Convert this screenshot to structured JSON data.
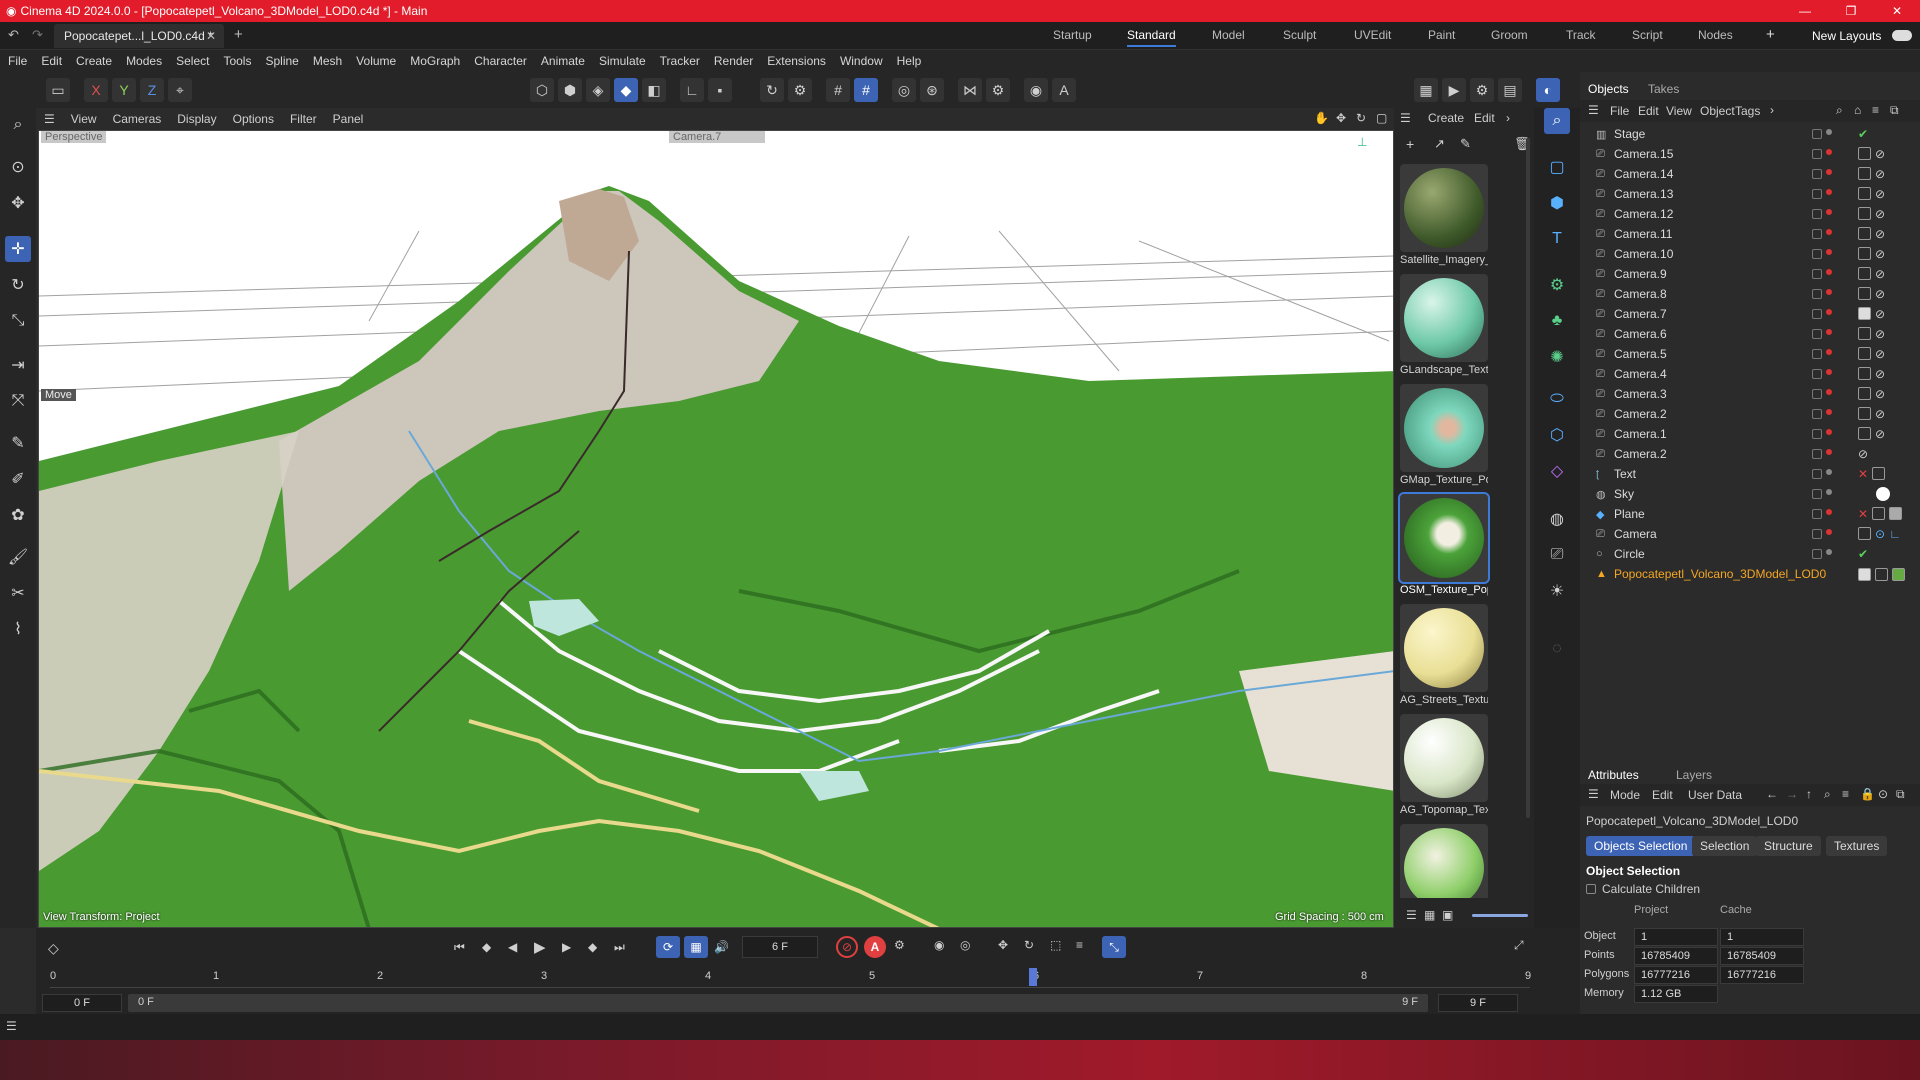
{
  "window": {
    "title": "Cinema 4D 2024.0.0 - [Popocatepetl_Volcano_3DModel_LOD0.c4d *] - Main",
    "minimize": "—",
    "maximize": "❐",
    "close": "✕"
  },
  "tabs": {
    "doc_tab": "Popocatepet...l_LOD0.c4d *",
    "layouts": [
      "Startup",
      "Standard",
      "Model",
      "Sculpt",
      "UVEdit",
      "Paint",
      "Groom",
      "Track",
      "Script",
      "Nodes"
    ],
    "active_layout": "Standard",
    "new_layouts": "New Layouts"
  },
  "menu": [
    "File",
    "Edit",
    "Create",
    "Modes",
    "Select",
    "Tools",
    "Spline",
    "Mesh",
    "Volume",
    "MoGraph",
    "Character",
    "Animate",
    "Simulate",
    "Tracker",
    "Render",
    "Extensions",
    "Window",
    "Help"
  ],
  "axes": {
    "x": "X",
    "y": "Y",
    "z": "Z"
  },
  "viewport": {
    "menu": [
      "View",
      "Cameras",
      "Display",
      "Options",
      "Filter",
      "Panel"
    ],
    "label": "Perspective",
    "camera": "Camera.7",
    "tool_label": "Move",
    "view_transform": "View Transform: Project",
    "grid_spacing": "Grid Spacing : 500 cm",
    "sky_color": "#ffffff",
    "terrain_color": "#3f8f2a"
  },
  "materials": {
    "menu": [
      "Create",
      "Edit"
    ],
    "items": [
      {
        "label": "Satellite_Imagery_",
        "color": "#3f5a2a"
      },
      {
        "label": "GLandscape_Textu",
        "color": "#6ec9a8"
      },
      {
        "label": "GMap_Texture_Po",
        "color": "#7ed8bd"
      },
      {
        "label": "OSM_Texture_Pop",
        "color": "#4ca33a"
      },
      {
        "label": "AG_Streets_Textur",
        "color": "#e9df95"
      },
      {
        "label": "AG_Topomap_Tex",
        "color": "#d9e6c8"
      },
      {
        "label": "",
        "color": "#8fcf6a"
      }
    ]
  },
  "objects": {
    "tabs": [
      "Objects",
      "Takes"
    ],
    "menu": [
      "File",
      "Edit",
      "View",
      "Object",
      "Tags"
    ],
    "items": [
      {
        "name": "Stage",
        "icon": "stage-icon"
      },
      {
        "name": "Camera.15",
        "icon": "camera-icon"
      },
      {
        "name": "Camera.14",
        "icon": "camera-icon"
      },
      {
        "name": "Camera.13",
        "icon": "camera-icon"
      },
      {
        "name": "Camera.12",
        "icon": "camera-icon"
      },
      {
        "name": "Camera.11",
        "icon": "camera-icon"
      },
      {
        "name": "Camera.10",
        "icon": "camera-icon"
      },
      {
        "name": "Camera.9",
        "icon": "camera-icon"
      },
      {
        "name": "Camera.8",
        "icon": "camera-icon"
      },
      {
        "name": "Camera.7",
        "icon": "camera-icon"
      },
      {
        "name": "Camera.6",
        "icon": "camera-icon"
      },
      {
        "name": "Camera.5",
        "icon": "camera-icon"
      },
      {
        "name": "Camera.4",
        "icon": "camera-icon"
      },
      {
        "name": "Camera.3",
        "icon": "camera-icon"
      },
      {
        "name": "Camera.2",
        "icon": "camera-icon"
      },
      {
        "name": "Camera.1",
        "icon": "camera-icon"
      },
      {
        "name": "Camera.2",
        "icon": "camera-icon"
      },
      {
        "name": "Text",
        "icon": "text-icon"
      },
      {
        "name": "Sky",
        "icon": "sky-icon"
      },
      {
        "name": "Plane",
        "icon": "plane-icon"
      },
      {
        "name": "Camera",
        "icon": "camera-icon"
      },
      {
        "name": "Circle",
        "icon": "circle-icon"
      },
      {
        "name": "Popocatepetl_Volcano_3DModel_LOD0",
        "icon": "polygon-icon"
      }
    ]
  },
  "attributes": {
    "tabs": [
      "Attributes",
      "Layers"
    ],
    "menu": [
      "Mode",
      "Edit",
      "User Data"
    ],
    "object_name": "Popocatepetl_Volcano_3DModel_LOD0",
    "subtabs": [
      "Objects Selection",
      "Selection",
      "Structure",
      "Textures"
    ],
    "section": "Object Selection",
    "calc_children": "Calculate Children",
    "col_project": "Project",
    "col_cache": "Cache",
    "rows": [
      {
        "label": "Object",
        "project": "1",
        "cache": "1"
      },
      {
        "label": "Points",
        "project": "16785409",
        "cache": "16785409"
      },
      {
        "label": "Polygons",
        "project": "16777216",
        "cache": "16777216"
      },
      {
        "label": "Memory",
        "project": "1.12 GB",
        "cache": ""
      }
    ]
  },
  "timeline": {
    "frame": "6 F",
    "ruler": [
      "0",
      "1",
      "2",
      "3",
      "4",
      "5",
      "6",
      "7",
      "8",
      "9"
    ],
    "current_frame_value": 6,
    "start": "0 F",
    "range_start": "0 F",
    "range_end": "9 F",
    "end": "9 F"
  }
}
